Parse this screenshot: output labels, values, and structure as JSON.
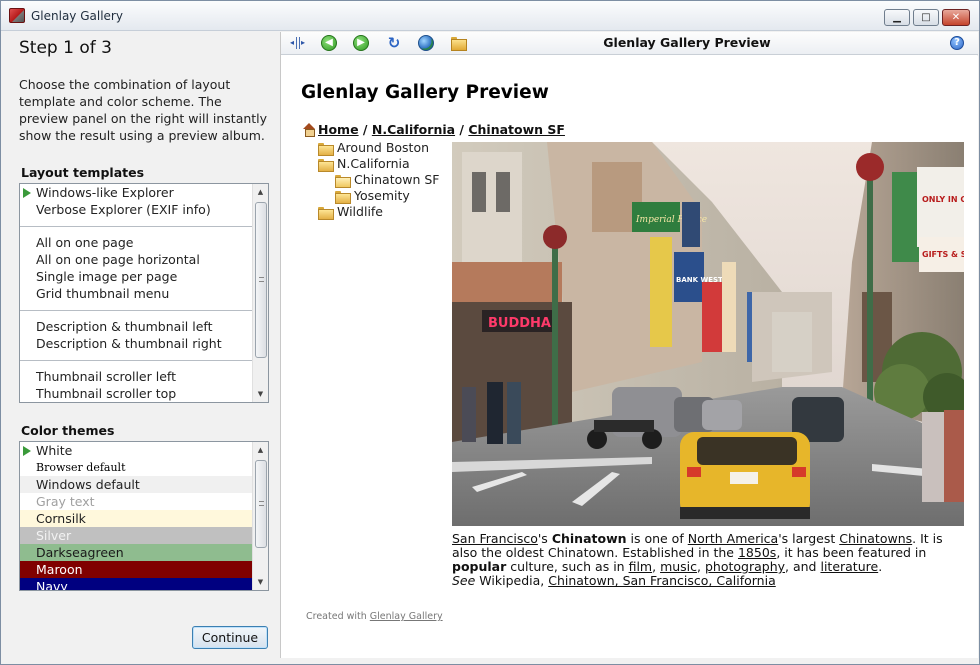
{
  "window": {
    "title": "Glenlay Gallery",
    "controls": {
      "minimize": "minimize",
      "maximize": "maximize",
      "close": "close"
    }
  },
  "sidebar": {
    "step_title": "Step 1 of 3",
    "description": "Choose the combination of layout template and color scheme. The preview panel on the right will instantly show the result using a preview album.",
    "layout_label": "Layout templates",
    "layout_groups": [
      [
        "Windows-like Explorer",
        "Verbose Explorer (EXIF info)"
      ],
      [
        "All on one page",
        "All on one page horizontal",
        "Single image per page",
        "Grid thumbnail menu"
      ],
      [
        "Description & thumbnail left",
        "Description & thumbnail right"
      ],
      [
        "Thumbnail scroller left",
        "Thumbnail scroller top"
      ]
    ],
    "color_label": "Color themes",
    "color_themes": [
      {
        "name": "White",
        "bg": "#ffffff",
        "fg": "#222222"
      },
      {
        "name": "Browser default",
        "bg": "#ffffff",
        "fg": "#000000"
      },
      {
        "name": "Windows default",
        "bg": "#f0f0f0",
        "fg": "#222222"
      },
      {
        "name": "Gray text",
        "bg": "#ffffff",
        "fg": "#a0a0a0"
      },
      {
        "name": "Cornsilk",
        "bg": "#fff8dc",
        "fg": "#222222"
      },
      {
        "name": "Silver",
        "bg": "#c0c0c0",
        "fg": "#f2f2f2"
      },
      {
        "name": "Darkseagreen",
        "bg": "#8fbc8f",
        "fg": "#1a1a1a"
      },
      {
        "name": "Maroon",
        "bg": "#800000",
        "fg": "#ffffff"
      },
      {
        "name": "Navy",
        "bg": "#000080",
        "fg": "#ffffff"
      }
    ],
    "continue_label": "Continue"
  },
  "toolbar": {
    "title": "Glenlay Gallery Preview",
    "icons": [
      "split-icon",
      "back-icon",
      "forward-icon",
      "refresh-icon",
      "globe-icon",
      "open-folder-icon",
      "help-icon"
    ]
  },
  "preview": {
    "title": "Glenlay Gallery Preview",
    "breadcrumb": {
      "home": "Home",
      "sep1": "/",
      "mid": "N.California",
      "sep2": "/",
      "current": "Chinatown SF"
    },
    "tree": {
      "around_boston": "Around Boston",
      "n_california": "N.California",
      "chinatown_sf": "Chinatown SF",
      "yosemite": "Yosemity",
      "wildlife": "Wildlife"
    },
    "caption": {
      "sf": "San Francisco",
      "t1": "'s ",
      "chinatown": "Chinatown",
      "t2": " is one of ",
      "na": "North America",
      "t3": "'s largest ",
      "chinatowns": "Chinatowns",
      "t4": ". It is also the oldest Chinatown. Established in the ",
      "y1850": "1850s",
      "t5": ", it has been featured in ",
      "popular": "popular",
      "t6": " culture, such as in ",
      "film": "film",
      "c1": ", ",
      "music": "music",
      "c2": ", ",
      "photography": "photography",
      "t7": ", and ",
      "literature": "literature",
      "t8": ".",
      "see": "See",
      "t9": " Wikipedia, ",
      "wiki": "Chinatown, San Francisco, California"
    },
    "photo_signs": {
      "buddha": "BUDDHA",
      "bank": "BANK WEST",
      "only": "ONLY IN CHINATOWN INC.",
      "gifts": "GIFTS & SOUVEN",
      "imperial": "Imperial Palace"
    },
    "created_prefix": "Created with ",
    "created_link": "Glenlay Gallery"
  }
}
